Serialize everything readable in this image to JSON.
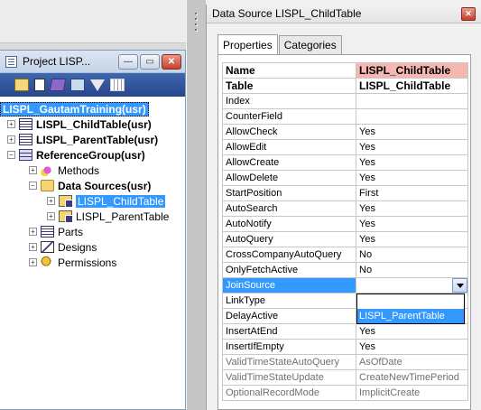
{
  "project": {
    "title": "Project LISP...",
    "window_buttons": {
      "minimize": "—",
      "restore": "▭",
      "close": "✕"
    },
    "tree": [
      {
        "label": "LISPL_GautamTraining(usr)",
        "level": 0,
        "bold": true,
        "selected_root": true,
        "icon": "project-root-icon",
        "expander": ""
      },
      {
        "label": "LISPL_ChildTable(usr)",
        "level": 0,
        "bold": true,
        "icon": "table-icon",
        "expander": "+"
      },
      {
        "label": "LISPL_ParentTable(usr)",
        "level": 0,
        "bold": true,
        "icon": "table-icon",
        "expander": "+"
      },
      {
        "label": "ReferenceGroup(usr)",
        "level": 0,
        "bold": true,
        "icon": "reference-group-icon",
        "expander": "−"
      },
      {
        "label": "Methods",
        "level": 1,
        "bold": false,
        "icon": "methods-icon",
        "expander": "+"
      },
      {
        "label": "Data Sources(usr)",
        "level": 1,
        "bold": true,
        "icon": "folder-icon",
        "expander": "−"
      },
      {
        "label": "LISPL_ChildTable",
        "level": 2,
        "bold": false,
        "selected": true,
        "icon": "datasource-icon",
        "expander": "+"
      },
      {
        "label": "LISPL_ParentTable",
        "level": 2,
        "bold": false,
        "icon": "datasource-icon",
        "expander": "+"
      },
      {
        "label": "Parts",
        "level": 1,
        "bold": false,
        "icon": "parts-icon",
        "expander": "+"
      },
      {
        "label": "Designs",
        "level": 1,
        "bold": false,
        "icon": "designs-icon",
        "expander": "+"
      },
      {
        "label": "Permissions",
        "level": 1,
        "bold": false,
        "icon": "permissions-icon",
        "expander": "+"
      }
    ]
  },
  "properties": {
    "title": "Data Source LISPL_ChildTable",
    "close_glyph": "✕",
    "tabs": [
      {
        "label": "Properties",
        "active": true
      },
      {
        "label": "Categories",
        "active": false
      }
    ],
    "rows": [
      {
        "name": "Name",
        "value": "LISPL_ChildTable",
        "style": "bold hdr"
      },
      {
        "name": "Table",
        "value": "LISPL_ChildTable",
        "style": "bold"
      },
      {
        "name": "Index",
        "value": "",
        "style": ""
      },
      {
        "name": "CounterField",
        "value": "",
        "style": ""
      },
      {
        "name": "AllowCheck",
        "value": "Yes",
        "style": ""
      },
      {
        "name": "AllowEdit",
        "value": "Yes",
        "style": ""
      },
      {
        "name": "AllowCreate",
        "value": "Yes",
        "style": ""
      },
      {
        "name": "AllowDelete",
        "value": "Yes",
        "style": ""
      },
      {
        "name": "StartPosition",
        "value": "First",
        "style": ""
      },
      {
        "name": "AutoSearch",
        "value": "Yes",
        "style": ""
      },
      {
        "name": "AutoNotify",
        "value": "Yes",
        "style": ""
      },
      {
        "name": "AutoQuery",
        "value": "Yes",
        "style": ""
      },
      {
        "name": "CrossCompanyAutoQuery",
        "value": "No",
        "style": ""
      },
      {
        "name": "OnlyFetchActive",
        "value": "No",
        "style": ""
      },
      {
        "name": "JoinSource",
        "value": "",
        "style": "sel"
      },
      {
        "name": "LinkType",
        "value": "",
        "style": ""
      },
      {
        "name": "DelayActive",
        "value": "",
        "style": ""
      },
      {
        "name": "InsertAtEnd",
        "value": "Yes",
        "style": ""
      },
      {
        "name": "InsertIfEmpty",
        "value": "Yes",
        "style": ""
      },
      {
        "name": "ValidTimeStateAutoQuery",
        "value": "AsOfDate",
        "style": "dim"
      },
      {
        "name": "ValidTimeStateUpdate",
        "value": "CreateNewTimePeriod",
        "style": "dim"
      },
      {
        "name": "OptionalRecordMode",
        "value": "ImplicitCreate",
        "style": "dim"
      }
    ],
    "dropdown_option": "LISPL_ParentTable"
  }
}
